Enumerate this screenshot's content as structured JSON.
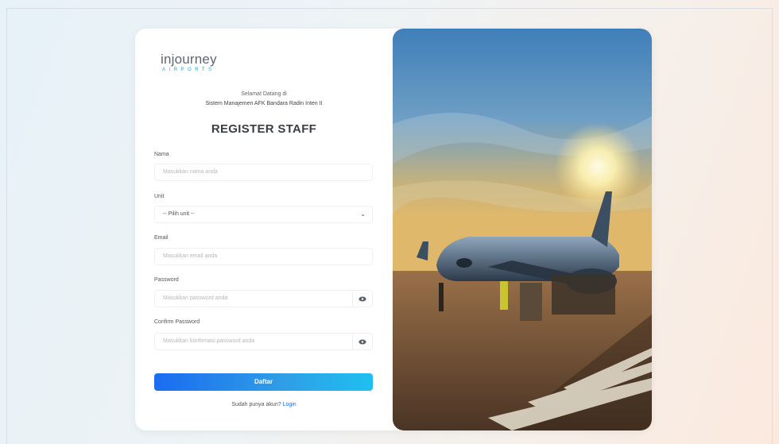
{
  "brand": {
    "name": "injourney",
    "sub": "AIRPORTS"
  },
  "welcome": {
    "line1": "Selamat Datang di",
    "line2": "Sistem Manajemen AFK Bandara Radin Inten II"
  },
  "title": "REGISTER STAFF",
  "fields": {
    "nama": {
      "label": "Nama",
      "placeholder": "Masukkan nama anda"
    },
    "unit": {
      "label": "Unit",
      "value": "-- Pilih unit --"
    },
    "email": {
      "label": "Email",
      "placeholder": "Masukkan email anda"
    },
    "password": {
      "label": "Password",
      "placeholder": "Masukkan password anda"
    },
    "confirm": {
      "label": "Confirm Password",
      "placeholder": "Masukkan konfirmasi password anda"
    }
  },
  "submit_label": "Daftar",
  "login": {
    "prompt": "Sudah punya akun?",
    "link": "Login"
  },
  "icons": {
    "eye": "eye-icon",
    "chevron": "chevron-down-icon"
  },
  "colors": {
    "accent": "#1a6cf0",
    "button_end": "#1ec0f0"
  }
}
